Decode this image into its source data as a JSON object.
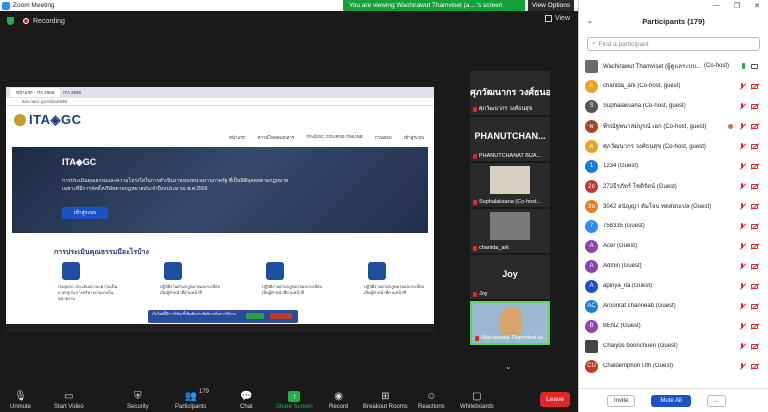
{
  "window": {
    "title": "Zoom Meeting",
    "banner": "You are viewing Wachirawut Thamviset (a....'s screen",
    "view_options": "View Options"
  },
  "topbar": {
    "recording": "Recording",
    "view": "View"
  },
  "shared": {
    "tab1": "หน้าแรก - ITA 2566",
    "tab2": "ITA 2566",
    "url": "itas.nacc.go.th/ita2566",
    "logo": "ITA◈GC",
    "nav": [
      "หน้าแรก",
      "ดาวน์โหลดเอกสาร",
      "ITA@GC COURSE ONLINE",
      "ถามตอบ",
      "เข้าสู่ระบบ"
    ],
    "hero_logo": "ITA◈GC",
    "hero_text": "การประเมินคุณธรรมและความโปร่งใสในการดำเนินงานของหน่วยงานภาครัฐ ที่เป็นนิติบุคคลตามกฎหมายเฉพาะที่มีการจัดตั้งบริษัทตามกฎหมายประจำปีงบประมาณ พ.ศ.2566",
    "hero_button": "เข้าสู่ระบบ",
    "section_title": "การประเมินคุณธรรมมีอะไรบ้าง",
    "cards": [
      "ITA@GC ประเมินสถานะความเป็นมาตรฐาน การบริหารงานภายในหน่วยงาน",
      "ปฏิบัติงานตามกฎหมายและระเบียบ เป็นผู้ทำหน้าที่ตามหน้าที่",
      "ปฏิบัติงานตามกฎหมายและระเบียบ เป็นผู้ทำหน้าที่ตามหน้าที่",
      "ปฏิบัติงานตามกฎหมายและระเบียบ เป็นผู้ทำหน้าที่ตามหน้าที่"
    ],
    "notif": "เว็บไซต์นี้มีการใช้คุกกี้เพื่อเพิ่มประสิทธิภาพในการใช้งาน"
  },
  "tiles": [
    {
      "name": "ศุภวัฒนากร วงศ์ธนอ...",
      "label": "ศุภวัฒนากร วงศ์ธนสุข",
      "type": "name"
    },
    {
      "name": "PHANUTCHAN...",
      "label": "PHANUTCHANAT BUA...",
      "type": "name"
    },
    {
      "name": "",
      "label": "Suphalaksana (Co-host...",
      "type": "photo"
    },
    {
      "name": "",
      "label": "chanida_ark",
      "type": "photo"
    },
    {
      "name": "Joy",
      "label": "Joy",
      "type": "name"
    },
    {
      "name": "",
      "label": "Wachirawut Thamviset (a...",
      "type": "video"
    }
  ],
  "toolbar": {
    "unmute": "Unmute",
    "start_video": "Start Video",
    "security": "Security",
    "participants": "Participants",
    "participants_count": "179",
    "chat": "Chat",
    "share": "Share Screen",
    "record": "Record",
    "breakout": "Breakout Rooms",
    "reactions": "Reactions",
    "whiteboards": "Whiteboards",
    "leave": "Leave"
  },
  "panel": {
    "title": "Participants (179)",
    "search_placeholder": "Find a participant",
    "participants": [
      {
        "name": "Wachirawut Thamviset (ผู้ดูแลระบบ...",
        "suffix": "(Co-host)",
        "initial": "",
        "color": "#6a6a6a",
        "photo": true
      },
      {
        "name": "chanida_ark (Co-host, guest)",
        "initial": "c",
        "color": "#f0a020"
      },
      {
        "name": "Suphalaksana (Co-host, guest)",
        "initial": "S",
        "color": "#555555"
      },
      {
        "name": "พีรณัฐพนาสมบูรณ์ เอก (Co-host, guest)",
        "initial": "พ",
        "color": "#a0482c"
      },
      {
        "name": "ศุภวัฒนากร วงศ์ธนสุข (Co-host, guest)",
        "initial": "ศ",
        "color": "#f0a020"
      },
      {
        "name": "1234 (Guest)",
        "initial": "1",
        "color": "#1a7dd4"
      },
      {
        "name": "272ธีรภัทร์ โชติรัตน์ (Guest)",
        "initial": "2ธ",
        "color": "#c0392b"
      },
      {
        "name": "3042 อนัญญา ดัมโจบ ทดสอบเปล (Guest)",
        "initial": "3อ",
        "color": "#e67e22"
      },
      {
        "name": "758335 (Guest)",
        "initial": "7",
        "color": "#2d8cff"
      },
      {
        "name": "Acer (Guest)",
        "initial": "A",
        "color": "#8e44ad"
      },
      {
        "name": "Admin (Guest)",
        "initial": "A",
        "color": "#8e44ad"
      },
      {
        "name": "apinya_ita (Guest)",
        "initial": "A",
        "color": "#1a54c4"
      },
      {
        "name": "Aroonrat channeab (Guest)",
        "initial": "AC",
        "color": "#1a7dd4"
      },
      {
        "name": "BENZ (Guest)",
        "initial": "B",
        "color": "#8e44ad"
      },
      {
        "name": "Chaiyos boonchuen (Guest)",
        "initial": "",
        "color": "#444",
        "photo": true
      },
      {
        "name": "Chaloemphon Uth (Guest)",
        "initial": "CU",
        "color": "#c0392b"
      }
    ],
    "invite": "Invite",
    "mute_all": "Mute All",
    "more": "..."
  }
}
